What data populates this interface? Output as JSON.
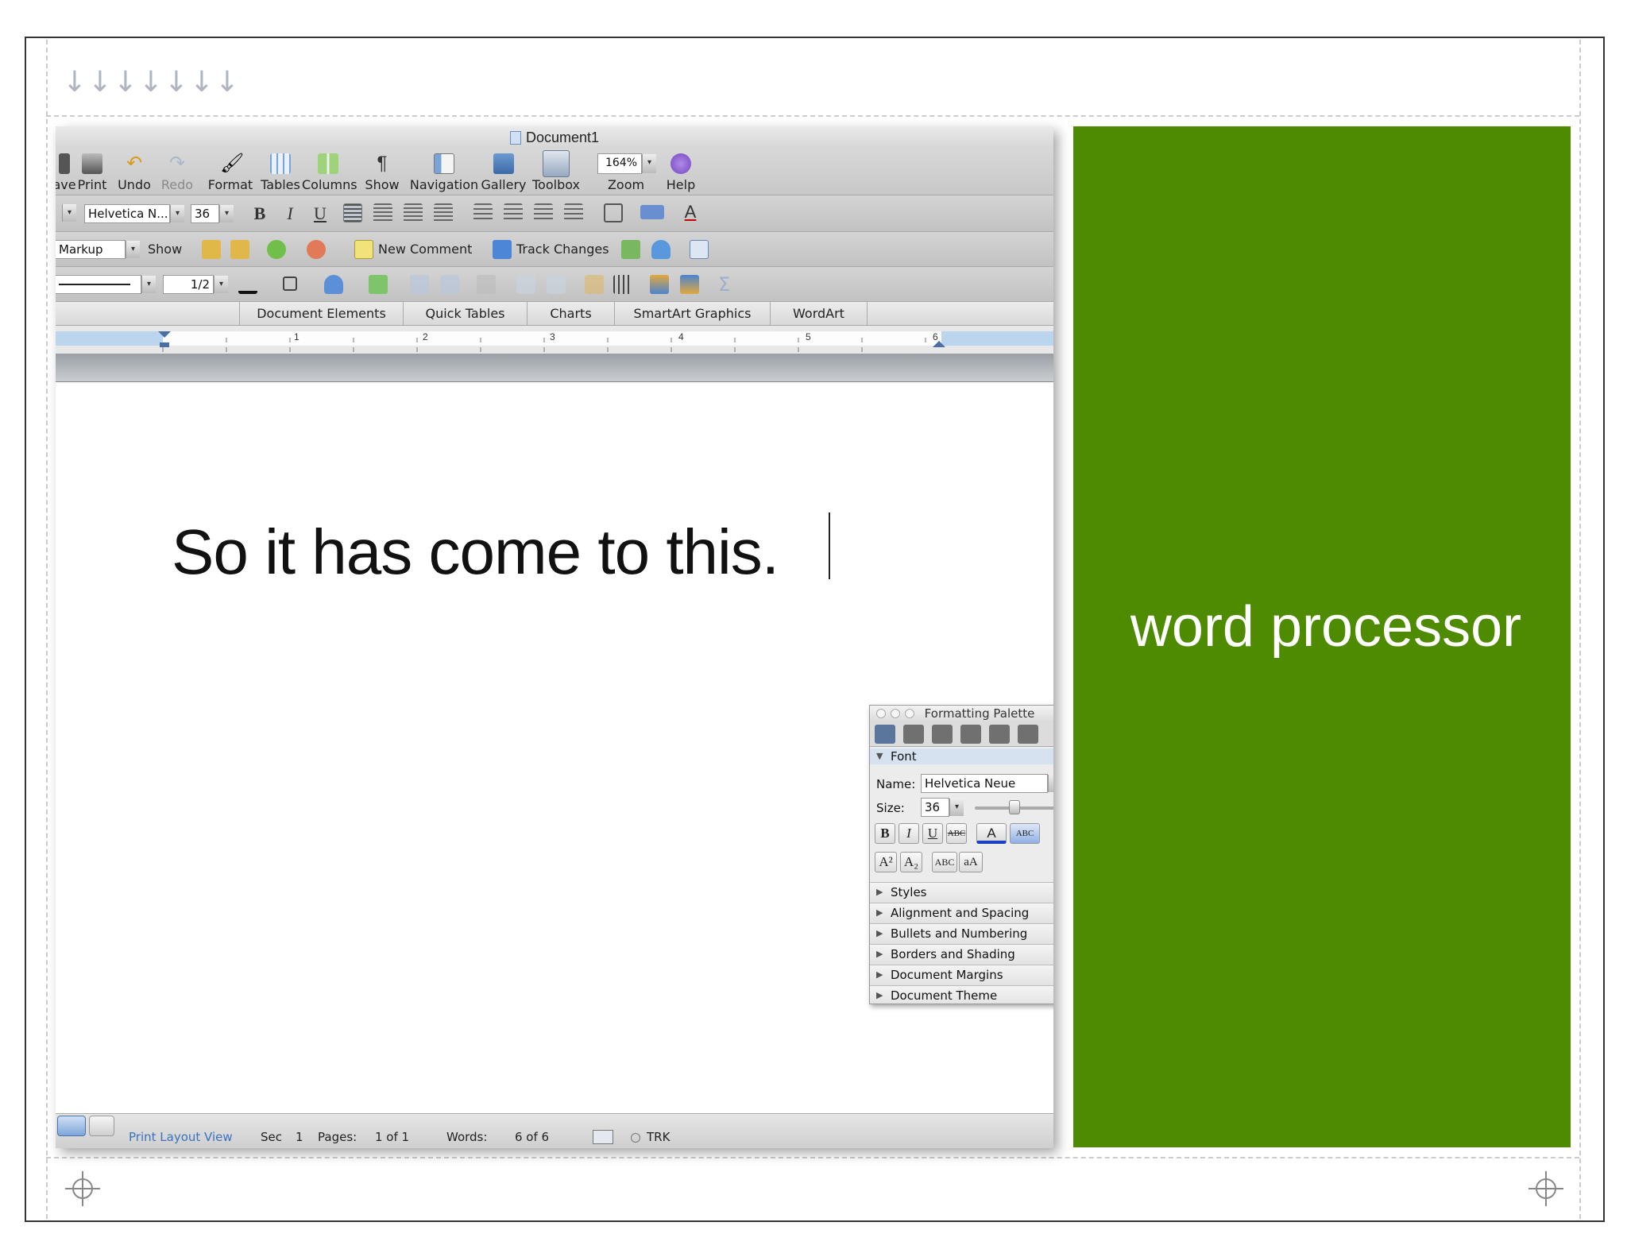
{
  "window": {
    "title": "Document1"
  },
  "standard_toolbar": {
    "items": [
      {
        "label": "ave",
        "icon": "save-icon",
        "dim": false
      },
      {
        "label": "Print",
        "icon": "print-icon",
        "dim": false
      },
      {
        "label": "Undo",
        "icon": "undo-icon",
        "dim": false
      },
      {
        "label": "Redo",
        "icon": "redo-icon",
        "dim": true
      },
      {
        "label": "Format",
        "icon": "format-brush-icon",
        "dim": false
      },
      {
        "label": "Tables",
        "icon": "tables-icon",
        "dim": false
      },
      {
        "label": "Columns",
        "icon": "columns-icon",
        "dim": false
      },
      {
        "label": "Show",
        "icon": "pilcrow-icon",
        "dim": false
      },
      {
        "label": "Navigation",
        "icon": "navigation-icon",
        "dim": false
      },
      {
        "label": "Gallery",
        "icon": "gallery-icon",
        "dim": false
      },
      {
        "label": "Toolbox",
        "icon": "toolbox-icon",
        "dim": false
      },
      {
        "label": "Zoom",
        "icon": "zoom-icon",
        "dim": false
      },
      {
        "label": "Help",
        "icon": "help-icon",
        "dim": false
      }
    ],
    "zoom_value": "164%"
  },
  "formatting_toolbar": {
    "font_name": "Helvetica N...",
    "font_size": "36",
    "bold": "B",
    "italic": "I",
    "underline": "U"
  },
  "review_toolbar": {
    "markup": "Markup",
    "show": "Show",
    "new_comment": "New Comment",
    "track_changes": "Track Changes"
  },
  "drawing_toolbar": {
    "line_weight": "1/2"
  },
  "ribbon_tabs": [
    "Document Elements",
    "Quick Tables",
    "Charts",
    "SmartArt Graphics",
    "WordArt"
  ],
  "ruler": {
    "marks": [
      "1",
      "2",
      "3",
      "4",
      "5",
      "6"
    ]
  },
  "document": {
    "text": "So it has come to this."
  },
  "statusbar": {
    "view": "Print Layout View",
    "sec_label": "Sec",
    "sec_value": "1",
    "pages_label": "Pages:",
    "pages_value": "1 of 1",
    "words_label": "Words:",
    "words_value": "6 of 6",
    "trk": "TRK"
  },
  "palette": {
    "title": "Formatting Palette",
    "font_header": "Font",
    "name_label": "Name:",
    "name_value": "Helvetica Neue",
    "size_label": "Size:",
    "size_value": "36",
    "size_slider_level": 0.45,
    "sections": [
      "Styles",
      "Alignment and Spacing",
      "Bullets and Numbering",
      "Borders and Shading",
      "Document Margins",
      "Document Theme"
    ]
  },
  "slide": {
    "label": "word processor",
    "accent": "#4e8b00"
  }
}
